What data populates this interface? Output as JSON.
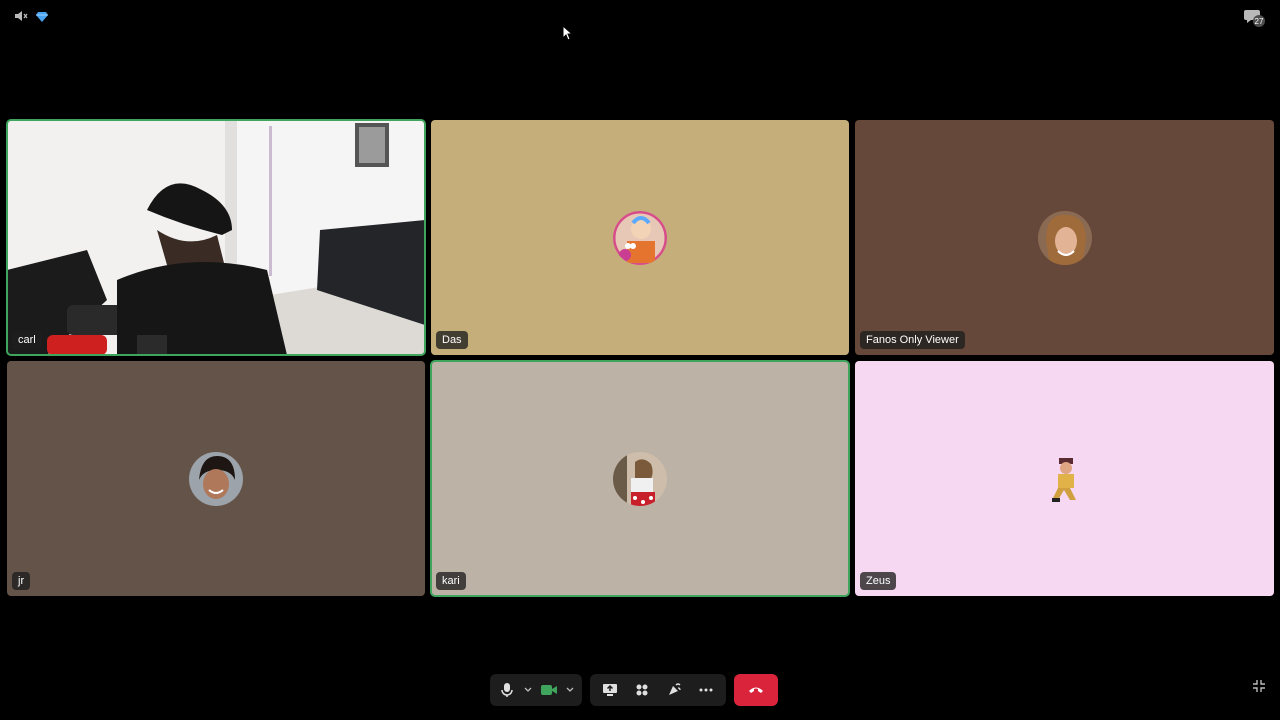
{
  "top_bar": {
    "left_icons": [
      "speaker-muted-icon",
      "diamond-icon"
    ],
    "chat_icon": "chat-bubble-icon",
    "chat_badge": "27"
  },
  "participants": [
    {
      "name": "carl",
      "speaking": true,
      "video": true
    },
    {
      "name": "Das",
      "speaking": false,
      "video": false,
      "bg": "#c5ae79"
    },
    {
      "name": "Fanos Only Viewer",
      "speaking": false,
      "video": false,
      "bg": "#65483a"
    },
    {
      "name": "jr",
      "speaking": false,
      "video": false,
      "bg": "#635348"
    },
    {
      "name": "kari",
      "speaking": true,
      "video": false,
      "bg": "#bdb2a6"
    },
    {
      "name": "Zeus",
      "speaking": false,
      "video": false,
      "bg": "#f6d8f2"
    }
  ],
  "controls": {
    "mic_icon": "microphone-icon",
    "camera_icon": "video-camera-icon",
    "share_icon": "screen-share-icon",
    "apps_icon": "activities-icon",
    "effects_icon": "soundboard-icon",
    "more_icon": "more-icon",
    "leave_icon": "hang-up-icon",
    "accent": "#3fa45c",
    "leave_color": "#d9243b"
  },
  "fullscreen_icon": "exit-fullscreen-icon"
}
